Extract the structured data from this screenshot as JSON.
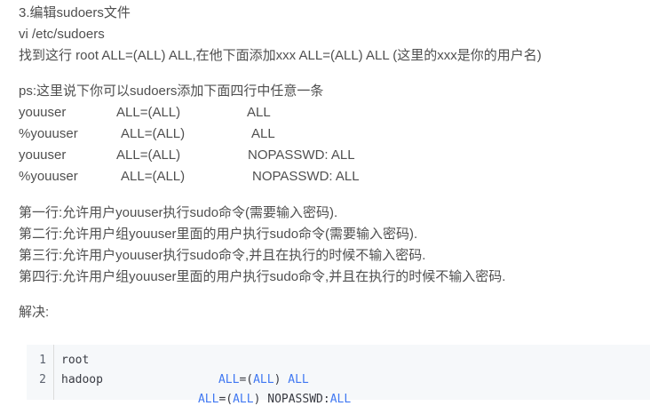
{
  "intro": {
    "heading": "3.编辑sudoers文件",
    "command": "vi /etc/sudoers",
    "instruction": "找到这行 root ALL=(ALL) ALL,在他下面添加xxx ALL=(ALL) ALL (这里的xxx是你的用户名)"
  },
  "ps_note": "ps:这里说下你可以sudoers添加下面四行中任意一条",
  "sudo_rules": [
    {
      "user": "youuser",
      "hosts": "ALL=(ALL)",
      "command": "ALL"
    },
    {
      "user": "%youuser",
      "hosts": "ALL=(ALL)",
      "command": "ALL"
    },
    {
      "user": "youuser",
      "hosts": "ALL=(ALL)",
      "command": "NOPASSWD: ALL"
    },
    {
      "user": "%youuser",
      "hosts": "ALL=(ALL)",
      "command": "NOPASSWD: ALL"
    }
  ],
  "explanations": [
    "第一行:允许用户youuser执行sudo命令(需要输入密码).",
    "第二行:允许用户组youuser里面的用户执行sudo命令(需要输入密码).",
    "第三行:允许用户youuser执行sudo命令,并且在执行的时候不输入密码.",
    "第四行:允许用户组youuser里面的用户执行sudo命令,并且在执行的时候不输入密码."
  ],
  "solution_label": "解决:",
  "code": {
    "lines": [
      {
        "number": "1",
        "user": "root",
        "spec": "ALL",
        "eq": "=(",
        "runas": "ALL",
        "close": ") ",
        "cmd": "ALL",
        "tail": ""
      },
      {
        "number": "2",
        "user": "hadoop",
        "spec": "ALL",
        "eq": "=(",
        "runas": "ALL",
        "close": ") NOPASSWD:",
        "cmd": "ALL",
        "tail": ""
      }
    ],
    "colors": {
      "keyword": "#4078f2",
      "text": "#383a42",
      "background": "#f6f8fa"
    }
  }
}
